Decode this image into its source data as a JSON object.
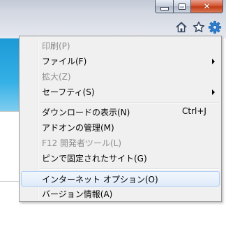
{
  "window": {
    "caption_buttons": {
      "minimize_icon": "minimize-icon",
      "maximize_icon": "maximize-icon",
      "close_icon": "close-icon",
      "close_glyph": "✕"
    }
  },
  "toolbar": {
    "icons": [
      "home-icon",
      "star-icon",
      "gear-icon"
    ]
  },
  "menu": {
    "items": [
      {
        "label": "印刷(P)",
        "disabled": true,
        "submenu": false,
        "shortcut": ""
      },
      {
        "label": "ファイル(F)",
        "disabled": false,
        "submenu": true,
        "shortcut": ""
      },
      {
        "label": "拡大(Z)",
        "disabled": true,
        "submenu": false,
        "shortcut": ""
      },
      {
        "label": "セーフティ(S)",
        "disabled": false,
        "submenu": true,
        "shortcut": ""
      },
      {
        "label": "ダウンロードの表示(N)",
        "disabled": false,
        "submenu": false,
        "shortcut": "Ctrl+J"
      },
      {
        "label": "アドオンの管理(M)",
        "disabled": false,
        "submenu": false,
        "shortcut": ""
      },
      {
        "label": "F12 開発者ツール(L)",
        "disabled": true,
        "submenu": false,
        "shortcut": ""
      },
      {
        "label": "ピンで固定されたサイト(G)",
        "disabled": false,
        "submenu": false,
        "shortcut": ""
      },
      {
        "label": "インターネット オプション(O)",
        "disabled": false,
        "submenu": false,
        "shortcut": "",
        "highlighted": true
      },
      {
        "label": "バージョン情報(A)",
        "disabled": false,
        "submenu": false,
        "shortcut": ""
      }
    ]
  },
  "colors": {
    "menu_background": "#f0f0f0",
    "highlight_border": "#aecff7",
    "disabled_text": "#8d8d8d",
    "gear_blue": "#2f7fd0",
    "content_blue": "#1b9ad6"
  }
}
